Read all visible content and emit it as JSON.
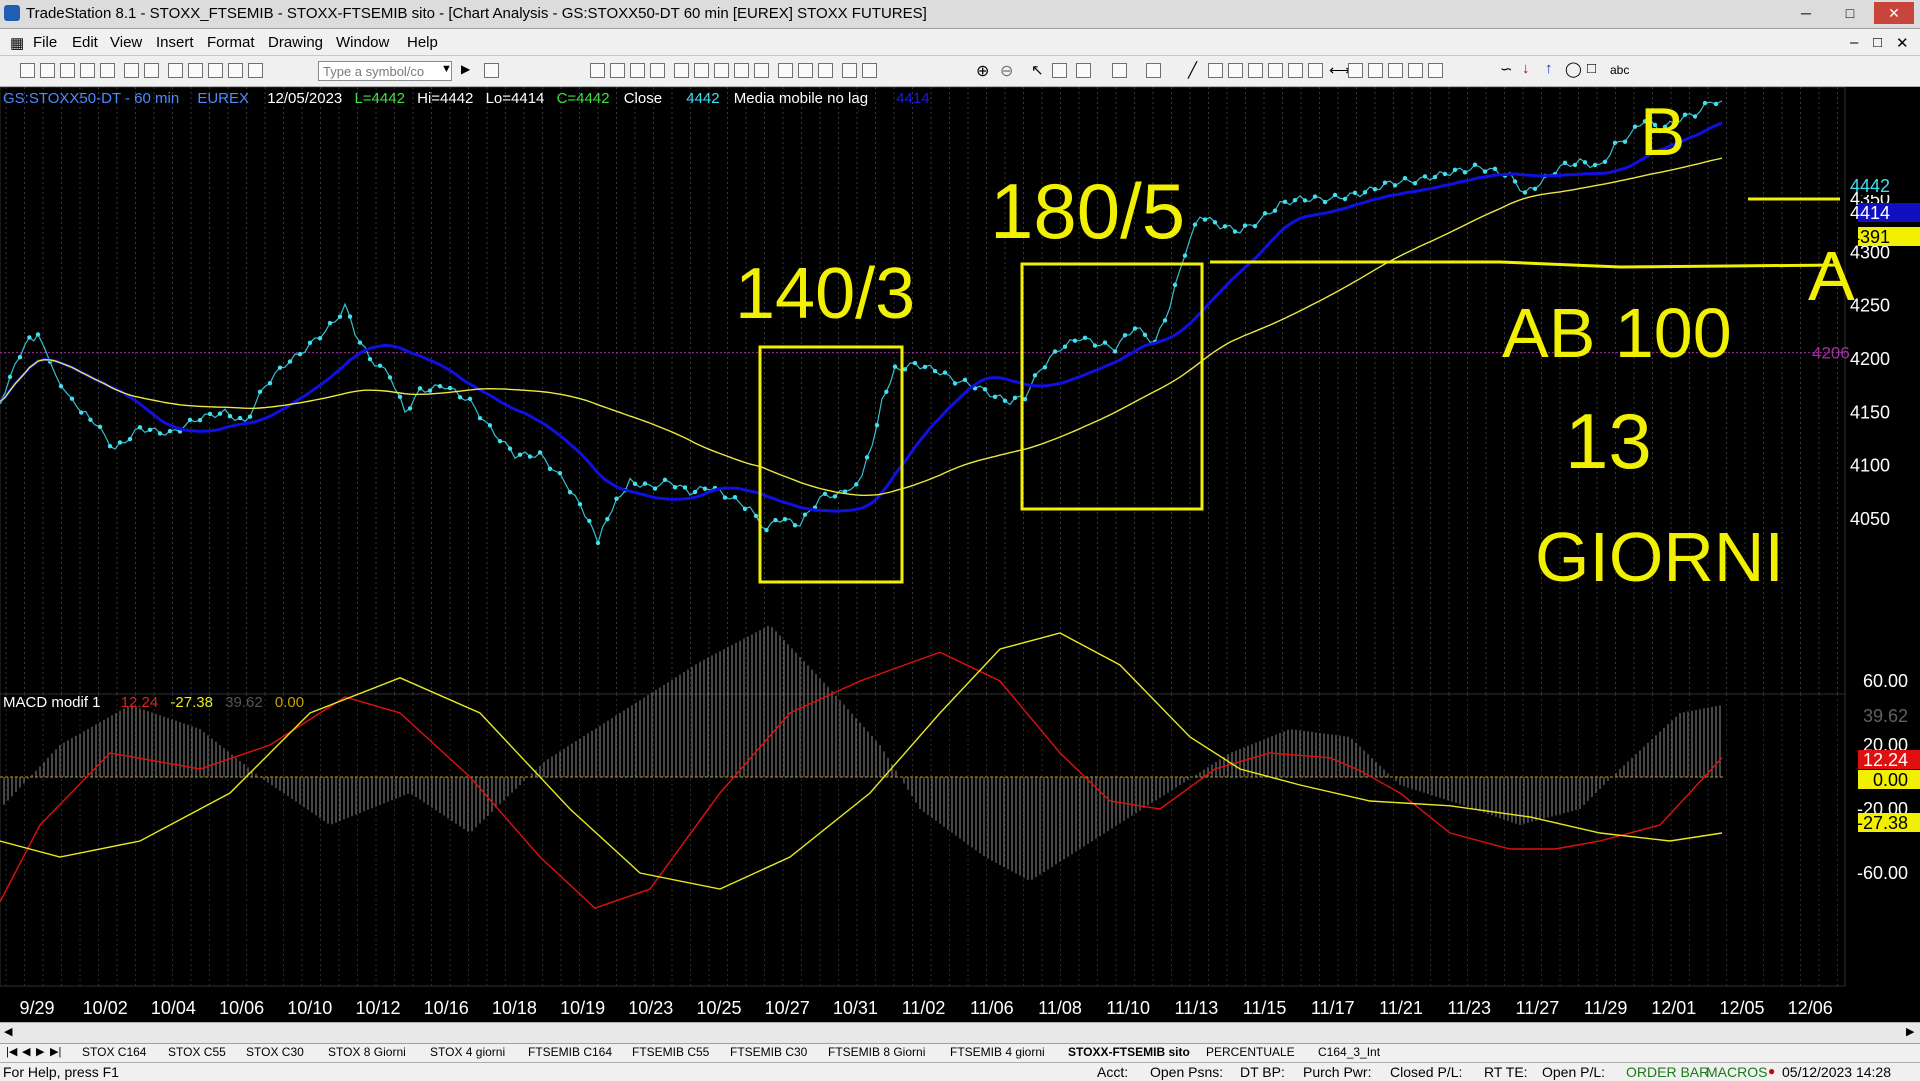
{
  "window": {
    "title": "TradeStation 8.1 - STOXX_FTSEMIB - STOXX-FTSEMIB sito - [Chart Analysis - GS:STOXX50-DT  60 min  [EUREX] STOXX FUTURES]"
  },
  "menu": [
    "File",
    "Edit",
    "View",
    "Insert",
    "Format",
    "Drawing",
    "Window",
    "Help"
  ],
  "toolbar": {
    "symbol_placeholder": "Type a symbol/co",
    "text_tool_label": "abc"
  },
  "price_header": {
    "symbol": "GS:STOXX50-DT - 60 min",
    "exchange": "EUREX",
    "date": "12/05/2023",
    "low": "L=4442",
    "high": "Hi=4442",
    "lo": "Lo=4414",
    "close": "C=4442",
    "close_label": "Close",
    "close_value": "4442",
    "indicator": "Media mobile no lag",
    "indicator_value": "4414"
  },
  "macd_header": {
    "name": "MACD modif 1",
    "v1": "12.24",
    "v2": "-27.38",
    "v3": "39.62",
    "v4": "0.00"
  },
  "price_axis": {
    "ticks": [
      "4350",
      "4300",
      "4250",
      "4200",
      "4150",
      "4100",
      "4050"
    ],
    "tags": [
      "4442",
      "4414",
      "4391"
    ],
    "level_label": "4206"
  },
  "macd_axis": {
    "ticks": [
      "60.00",
      "20.00",
      "0.00",
      "-20.00",
      "-60.00"
    ],
    "tags": [
      "39.62",
      "12.24",
      "0.00",
      "-27.38"
    ]
  },
  "time_axis": [
    "9/29",
    "10/02",
    "10/04",
    "10/06",
    "10/10",
    "10/12",
    "10/16",
    "10/18",
    "10/19",
    "10/23",
    "10/25",
    "10/27",
    "10/31",
    "11/02",
    "11/06",
    "11/08",
    "11/10",
    "11/13",
    "11/15",
    "11/17",
    "11/21",
    "11/23",
    "11/27",
    "11/29",
    "12/01",
    "12/05",
    "12/06"
  ],
  "annotations": {
    "a": "140/3",
    "b": "180/5",
    "c": "AB 100",
    "d": "13",
    "e": "GIORNI",
    "f": "B",
    "g": "A"
  },
  "tabs": [
    "STOX C164",
    "STOX C55",
    "STOX  C30",
    "STOX  8 Giorni",
    "STOX 4 giorni",
    "FTSEMIB C164",
    "FTSEMIB C55",
    "FTSEMIB C30",
    "FTSEMIB  8 Giorni",
    "FTSEMIB  4 giorni",
    "STOXX-FTSEMIB sito",
    "PERCENTUALE",
    "C164_3_Int"
  ],
  "status": {
    "help": "For Help, press F1",
    "acct": "Acct:",
    "open_psns": "Open Psns:",
    "dt_bp": "DT BP:",
    "purch_pwr": "Purch Pwr:",
    "closed_pl": "Closed P/L:",
    "rt_te": "RT TE:",
    "open_pl": "Open P/L:",
    "order_bar": "ORDER BAR",
    "macros": "MACROS",
    "datetime": "05/12/2023 14:28"
  },
  "colors": {
    "price": "#40e0f0",
    "ma_blue": "#1010e0",
    "ma_yellow": "#e8e840",
    "macd_red": "#e01010",
    "macd_yellow": "#e8e820",
    "hist": "#8c8c8c",
    "annot": "#f0f000"
  }
}
